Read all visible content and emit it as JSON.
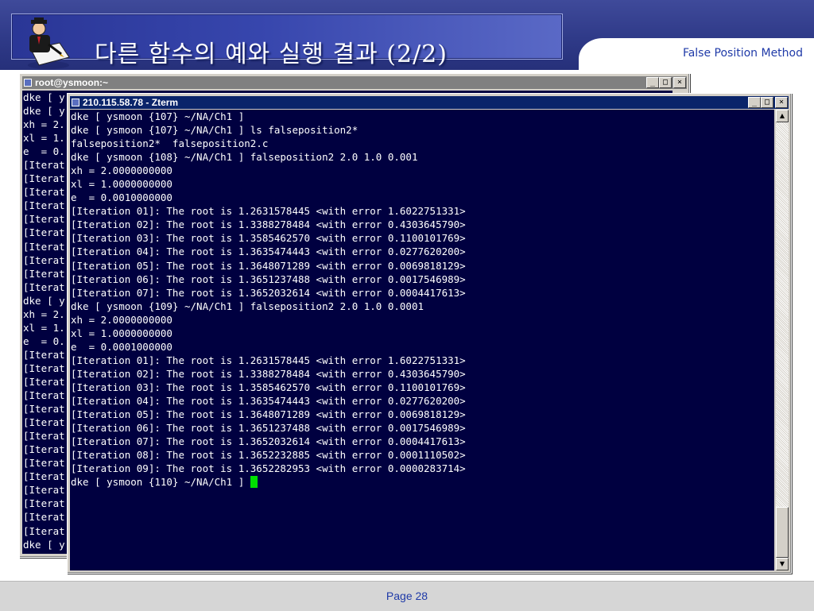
{
  "slide": {
    "title": "다른 함수의 예와 실행 결과 (2/2)",
    "subtitle": "False Position Method",
    "page": "Page 28",
    "colors": {
      "header": "#2f3a88",
      "accent_text": "#1f3aa8",
      "terminal_bg": "#000040",
      "cursor": "#00e000"
    },
    "icon": "presenter-writing-icon"
  },
  "back_window": {
    "title": "root@ysmoon:~",
    "controls": [
      "_",
      "□",
      "×"
    ],
    "lines": [
      "dke [ y",
      "dke [ y",
      "xh = 2.",
      "xl = 1.",
      "e  = 0.",
      "[Iterat",
      "[Iterat",
      "[Iterat",
      "[Iterat",
      "[Iterat",
      "[Iterat",
      "[Iterat",
      "[Iterat",
      "[Iterat",
      "[Iterat",
      "dke [ y",
      "xh = 2.",
      "xl = 1.",
      "e  = 0.",
      "[Iterat",
      "[Iterat",
      "[Iterat",
      "[Iterat",
      "[Iterat",
      "[Iterat",
      "[Iterat",
      "[Iterat",
      "[Iterat",
      "[Iterat",
      "[Iterat",
      "[Iterat",
      "[Iterat",
      "[Iterat",
      "dke [ y"
    ]
  },
  "front_window": {
    "title": "210.115.58.78 - Zterm",
    "controls": [
      "_",
      "□",
      "×"
    ],
    "lines": [
      "dke [ ysmoon {107} ~/NA/Ch1 ]",
      "dke [ ysmoon {107} ~/NA/Ch1 ] ls falseposition2*",
      "falseposition2*  falseposition2.c",
      "dke [ ysmoon {108} ~/NA/Ch1 ] falseposition2 2.0 1.0 0.001",
      "xh = 2.0000000000",
      "xl = 1.0000000000",
      "e  = 0.0010000000",
      "[Iteration 01]: The root is 1.2631578445 <with error 1.6022751331>",
      "[Iteration 02]: The root is 1.3388278484 <with error 0.4303645790>",
      "[Iteration 03]: The root is 1.3585462570 <with error 0.1100101769>",
      "[Iteration 04]: The root is 1.3635474443 <with error 0.0277620200>",
      "[Iteration 05]: The root is 1.3648071289 <with error 0.0069818129>",
      "[Iteration 06]: The root is 1.3651237488 <with error 0.0017546989>",
      "[Iteration 07]: The root is 1.3652032614 <with error 0.0004417613>",
      "dke [ ysmoon {109} ~/NA/Ch1 ] falseposition2 2.0 1.0 0.0001",
      "xh = 2.0000000000",
      "xl = 1.0000000000",
      "e  = 0.0001000000",
      "[Iteration 01]: The root is 1.2631578445 <with error 1.6022751331>",
      "[Iteration 02]: The root is 1.3388278484 <with error 0.4303645790>",
      "[Iteration 03]: The root is 1.3585462570 <with error 0.1100101769>",
      "[Iteration 04]: The root is 1.3635474443 <with error 0.0277620200>",
      "[Iteration 05]: The root is 1.3648071289 <with error 0.0069818129>",
      "[Iteration 06]: The root is 1.3651237488 <with error 0.0017546989>",
      "[Iteration 07]: The root is 1.3652032614 <with error 0.0004417613>",
      "[Iteration 08]: The root is 1.3652232885 <with error 0.0001110502>",
      "[Iteration 09]: The root is 1.3652282953 <with error 0.0000283714>",
      "dke [ ysmoon {110} ~/NA/Ch1 ] "
    ]
  }
}
